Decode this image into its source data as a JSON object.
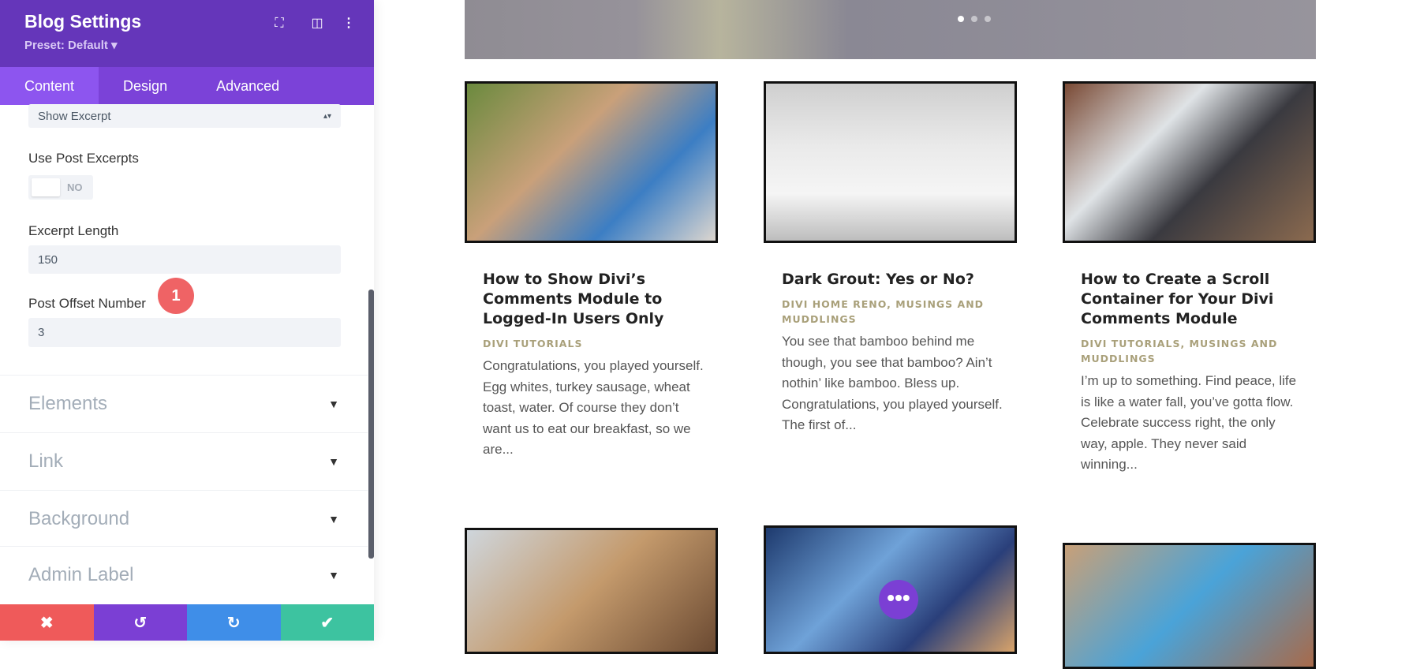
{
  "sidebar": {
    "title": "Blog Settings",
    "preset": "Preset: Default ▾",
    "icons": [
      "fullscreen-icon",
      "split-view-icon",
      "more-options-icon"
    ],
    "tabs": [
      "Content",
      "Design",
      "Advanced"
    ],
    "active_tab": "Content",
    "excerpt_select": "Show Excerpt",
    "use_post_excerpts": {
      "label": "Use Post Excerpts",
      "value": "NO"
    },
    "excerpt_length": {
      "label": "Excerpt Length",
      "value": "150"
    },
    "post_offset": {
      "label": "Post Offset Number",
      "value": "3",
      "badge": "1"
    },
    "sections": [
      "Elements",
      "Link",
      "Background",
      "Admin Label"
    ],
    "footer": {
      "cancel": "✖",
      "undo": "↺",
      "redo": "↻",
      "save": "✔"
    },
    "colors": {
      "header": "#6536ba",
      "tabs": "#7b42d8",
      "cancel": "#ef5a5a",
      "undo": "#7b3fd4",
      "redo": "#3f8ee8",
      "save": "#3dc3a0"
    }
  },
  "main": {
    "posts": [
      {
        "title": "How to Show Divi’s Comments Module to Logged-In Users Only",
        "category": "DIVI TUTORIALS",
        "excerpt": "Congratulations, you played yourself. Egg whites, turkey sausage, wheat toast, water. Of course they don’t want us to eat our breakfast, so we are..."
      },
      {
        "title": "Dark Grout: Yes or No?",
        "category": "DIVI HOME RENO, MUSINGS AND MUDDLINGS",
        "excerpt": "You see that bamboo behind me though, you see that bamboo? Ain’t nothin’ like bamboo. Bless up. Congratulations, you played yourself. The first of..."
      },
      {
        "title": "How to Create a Scroll Container for Your Divi Comments Module",
        "category": "DIVI TUTORIALS, MUSINGS AND MUDDLINGS",
        "excerpt": "I’m up to something. Find peace, life is like a water fall, you’ve gotta flow. Celebrate success right, the only way, apple. They never said winning..."
      }
    ],
    "more_button": "•••"
  }
}
